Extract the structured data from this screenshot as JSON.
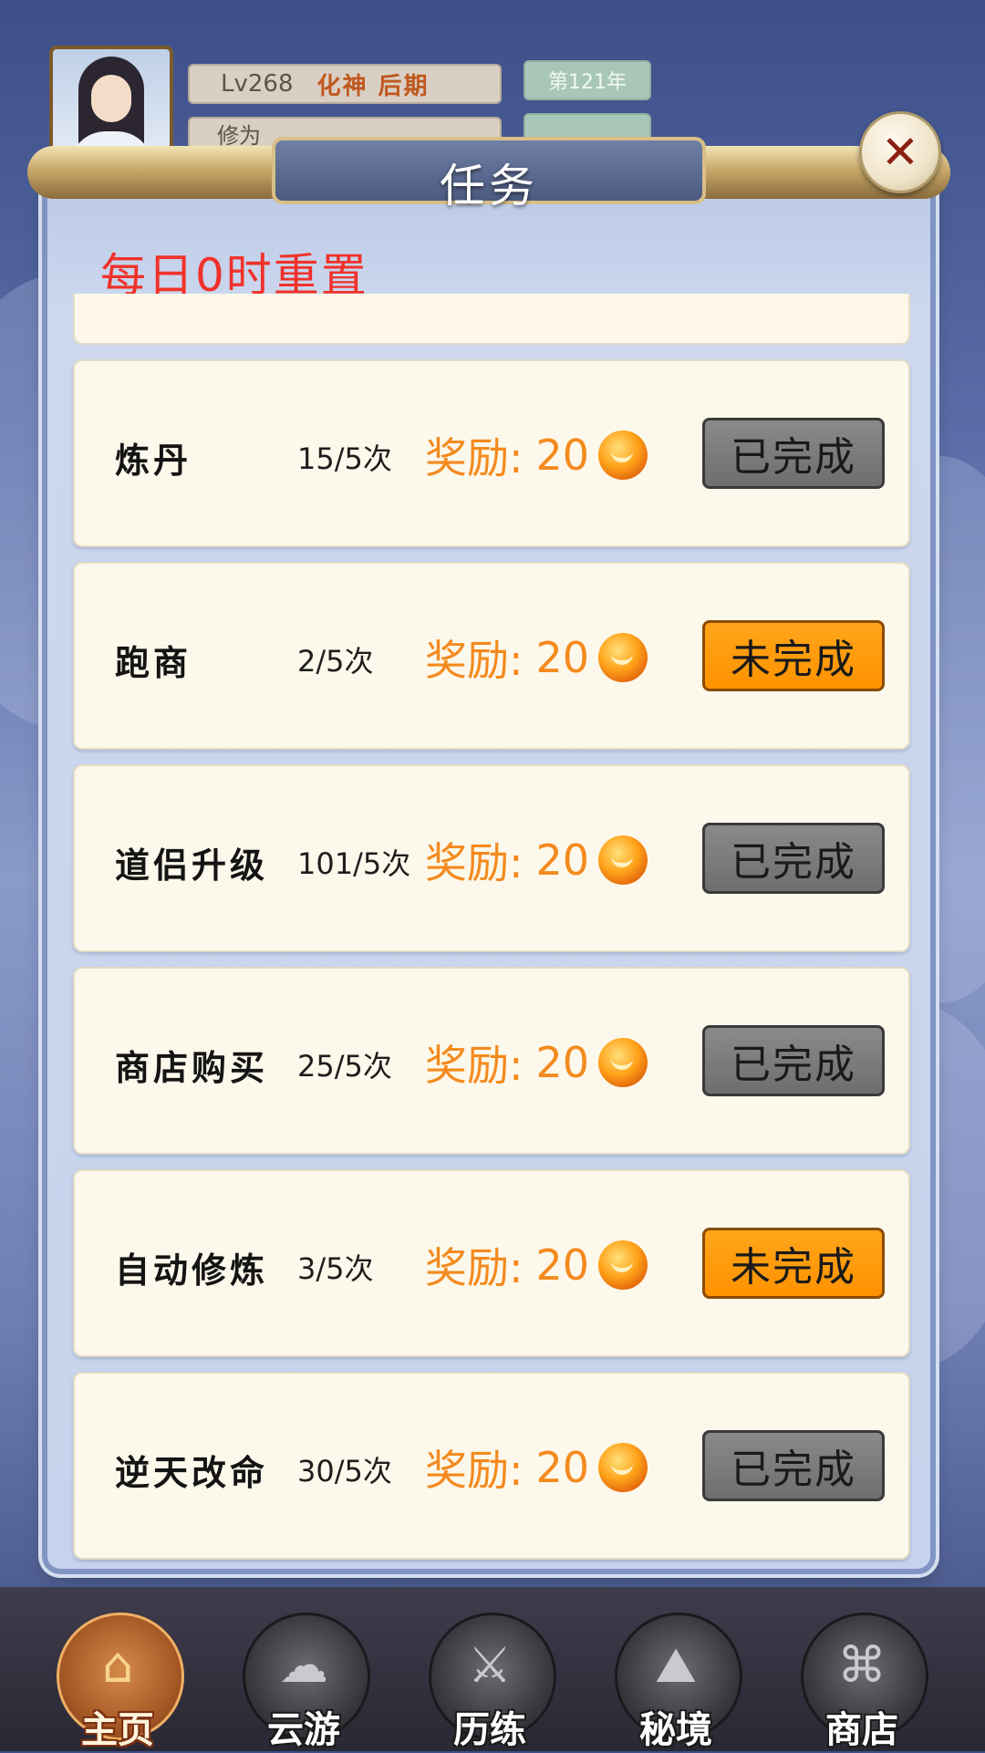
{
  "player": {
    "level": "Lv268",
    "realm": "化神 后期",
    "year": "第121年",
    "cultivation_label": "修为"
  },
  "dialog": {
    "title": "任务",
    "close_icon": "close-icon",
    "reset_note": "每日0时重置"
  },
  "tasks": [
    {
      "name": "炼丹",
      "progress": "15/5次",
      "reward_label": "奖励:",
      "reward_amount": "20",
      "status": "已完成",
      "done": true
    },
    {
      "name": "跑商",
      "progress": "2/5次",
      "reward_label": "奖励:",
      "reward_amount": "20",
      "status": "未完成",
      "done": false
    },
    {
      "name": "道侣升级",
      "progress": "101/5次",
      "reward_label": "奖励:",
      "reward_amount": "20",
      "status": "已完成",
      "done": true
    },
    {
      "name": "商店购买",
      "progress": "25/5次",
      "reward_label": "奖励:",
      "reward_amount": "20",
      "status": "已完成",
      "done": true
    },
    {
      "name": "自动修炼",
      "progress": "3/5次",
      "reward_label": "奖励:",
      "reward_amount": "20",
      "status": "未完成",
      "done": false
    },
    {
      "name": "逆天改命",
      "progress": "30/5次",
      "reward_label": "奖励:",
      "reward_amount": "20",
      "status": "已完成",
      "done": true
    }
  ],
  "colors": {
    "reward_text": "#f48a1e",
    "reset_note": "#f0322a",
    "done_button": "#7a7a7a",
    "todo_button": "#ff9a0c"
  },
  "nav": {
    "items": [
      {
        "label": "主页",
        "icon": "home-icon",
        "active": true
      },
      {
        "label": "云游",
        "icon": "travel-icon",
        "active": false
      },
      {
        "label": "历练",
        "icon": "training-icon",
        "active": false
      },
      {
        "label": "秘境",
        "icon": "secret-realm-icon",
        "active": false
      },
      {
        "label": "商店",
        "icon": "shop-icon",
        "active": false
      }
    ]
  }
}
